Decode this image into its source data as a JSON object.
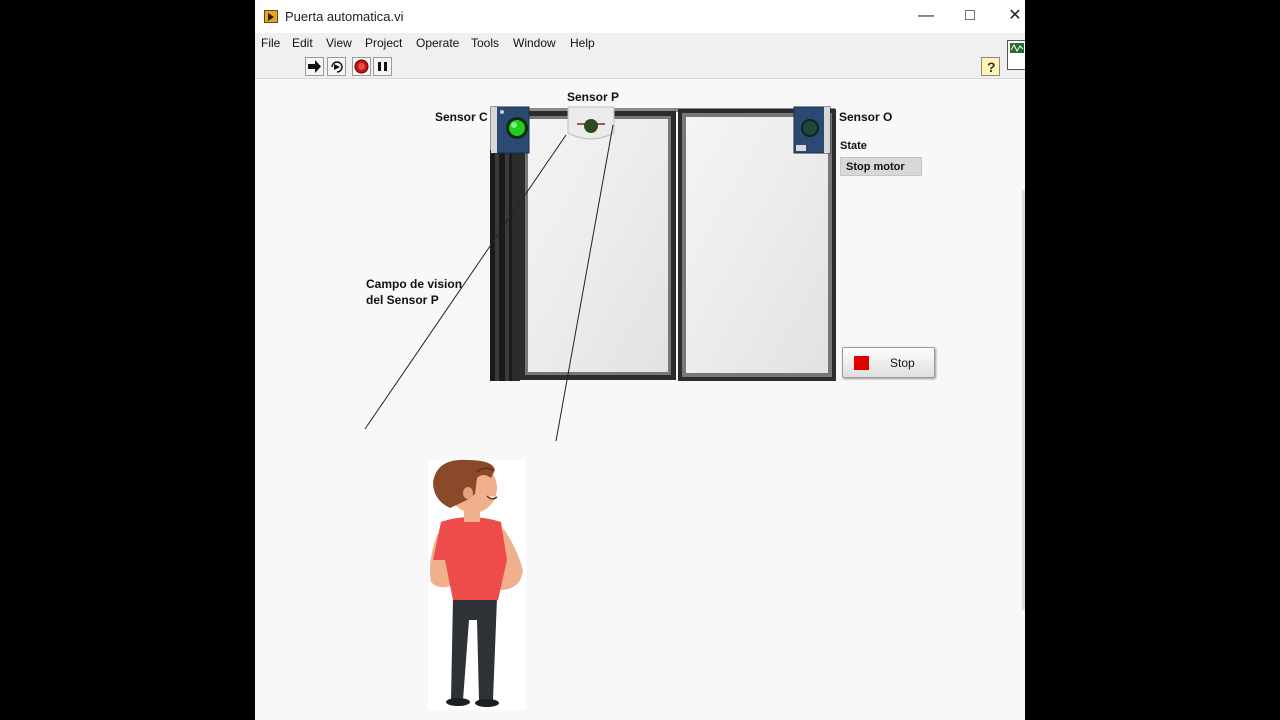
{
  "window": {
    "title": "Puerta automatica.vi"
  },
  "menu": [
    "File",
    "Edit",
    "View",
    "Project",
    "Operate",
    "Tools",
    "Window",
    "Help"
  ],
  "toolbar": {
    "run_icon": "run-arrow-icon",
    "continuous_icon": "run-continuously-icon",
    "abort_icon": "abort-icon",
    "pause_icon": "pause-icon",
    "help_icon": "context-help-icon",
    "help_glyph": "?"
  },
  "panel": {
    "sensor_c_label": "Sensor C",
    "sensor_p_label": "Sensor P",
    "sensor_o_label": "Sensor O",
    "sensor_c_led_color": "#22cc22",
    "sensor_p_led_color": "#2d4a1f",
    "sensor_o_led_color": "#1f4738",
    "state_label": "State",
    "state_value": "Stop motor",
    "vision_label_line1": "Campo de vision",
    "vision_label_line2": "del Sensor P",
    "stop_button_label": "Stop",
    "stop_led_color": "#e00000"
  }
}
